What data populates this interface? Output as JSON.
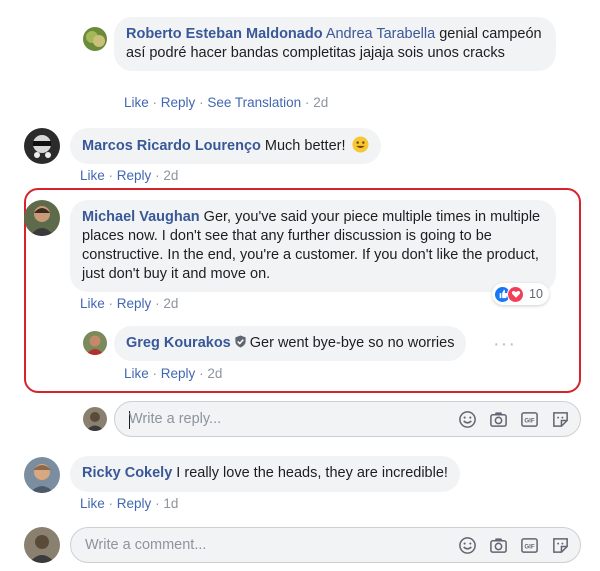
{
  "comments": {
    "roberto": {
      "author": "Roberto Esteban Maldonado",
      "mention": "Andrea Tarabella",
      "text": " genial campeón así podré hacer bandas completitas jajaja sois unos cracks",
      "like": "Like",
      "reply": "Reply",
      "translate": "See Translation",
      "time": "2d"
    },
    "marcos": {
      "author": "Marcos Ricardo Lourenço",
      "text": " Much better!",
      "like": "Like",
      "reply": "Reply",
      "time": "2d"
    },
    "michael": {
      "author": "Michael Vaughan",
      "text": " Ger, you've said your piece multiple times in multiple places now. I don't see that any further discussion is going to be constructive. In the end, you're a customer. If you don't like the product, just don't buy it and move on.",
      "like": "Like",
      "reply": "Reply",
      "time": "2d",
      "reaction_count": "10"
    },
    "greg": {
      "author": "Greg Kourakos",
      "text": "Ger went bye-bye so no worries",
      "like": "Like",
      "reply": "Reply",
      "time": "2d"
    },
    "ricky": {
      "author": "Ricky Cokely",
      "text": " I really love the heads, they are incredible!",
      "like": "Like",
      "reply": "Reply",
      "time": "1d"
    }
  },
  "reply_box": {
    "placeholder": "Write a reply..."
  },
  "comment_box": {
    "placeholder": "Write a comment..."
  },
  "colors": {
    "link": "#385898",
    "highlight": "#d7232b",
    "like_blue": "#1877f2",
    "love_red": "#f33e58"
  }
}
